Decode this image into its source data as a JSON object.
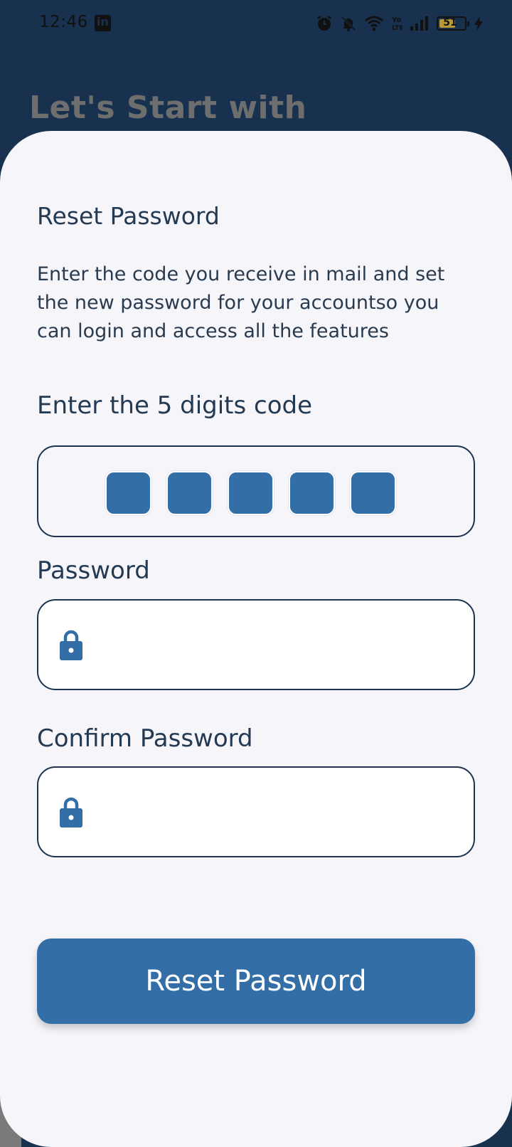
{
  "status_bar": {
    "time": "12:46",
    "battery_level": "51",
    "icons": [
      "linkedin-icon",
      "alarm-icon",
      "bell-off-icon",
      "wifi-icon",
      "volte-icon",
      "signal-icon",
      "battery-icon",
      "charging-icon"
    ]
  },
  "hero": {
    "title": "Let's Start with"
  },
  "form": {
    "title": "Reset Password",
    "description": "Enter the code you receive in mail and set the new password for your accountso you can login and access all the features",
    "code_label": "Enter the 5 digits code",
    "code_digits": [
      "",
      "",
      "",
      "",
      ""
    ],
    "password_label": "Password",
    "password_value": "",
    "confirm_label": "Confirm Password",
    "confirm_value": "",
    "submit_label": "Reset Password"
  },
  "colors": {
    "header_bg": "#18314f",
    "sheet_bg": "#f5f5fa",
    "accent": "#336ea6",
    "text_dark": "#243a52"
  }
}
